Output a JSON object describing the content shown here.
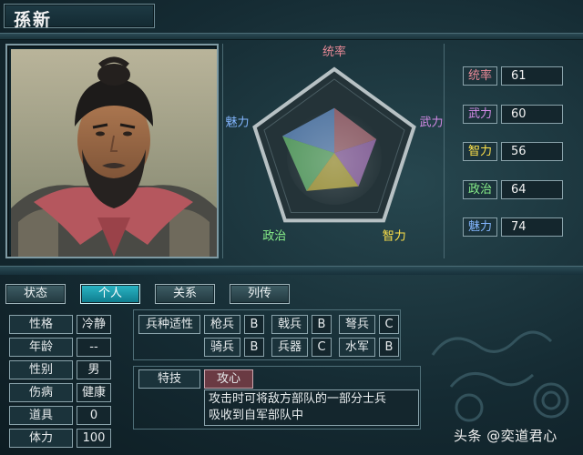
{
  "character": {
    "name": "孫新"
  },
  "radar": {
    "axes": [
      "统率",
      "武力",
      "智力",
      "政治",
      "魅力"
    ],
    "values": [
      61,
      60,
      56,
      64,
      74
    ],
    "max": 100
  },
  "stats": [
    {
      "label": "统率",
      "value": "61",
      "color": "#e98a97"
    },
    {
      "label": "武力",
      "value": "60",
      "color": "#d58be8"
    },
    {
      "label": "智力",
      "value": "56",
      "color": "#ffe24a"
    },
    {
      "label": "政治",
      "value": "64",
      "color": "#88f08a"
    },
    {
      "label": "魅力",
      "value": "74",
      "color": "#83b6ff"
    }
  ],
  "tabs": [
    "状态",
    "个人",
    "关系",
    "列传"
  ],
  "active_tab": "个人",
  "personal": [
    {
      "label": "性格",
      "value": "冷静"
    },
    {
      "label": "年龄",
      "value": "--"
    },
    {
      "label": "性别",
      "value": "男"
    },
    {
      "label": "伤病",
      "value": "健康"
    },
    {
      "label": "道具",
      "value": "0"
    },
    {
      "label": "体力",
      "value": "100"
    }
  ],
  "aptitude": {
    "title": "兵种适性",
    "units": [
      {
        "name": "枪兵",
        "grade": "B"
      },
      {
        "name": "戟兵",
        "grade": "B"
      },
      {
        "name": "弩兵",
        "grade": "C"
      },
      {
        "name": "骑兵",
        "grade": "B"
      },
      {
        "name": "兵器",
        "grade": "C"
      },
      {
        "name": "水军",
        "grade": "B"
      }
    ]
  },
  "skill": {
    "label": "特技",
    "name": "攻心",
    "desc_line1": "攻击时可将敌方部队的一部分士兵",
    "desc_line2": "吸收到自军部队中"
  },
  "watermark": {
    "platform": "头条",
    "author": "@奕道君心"
  }
}
